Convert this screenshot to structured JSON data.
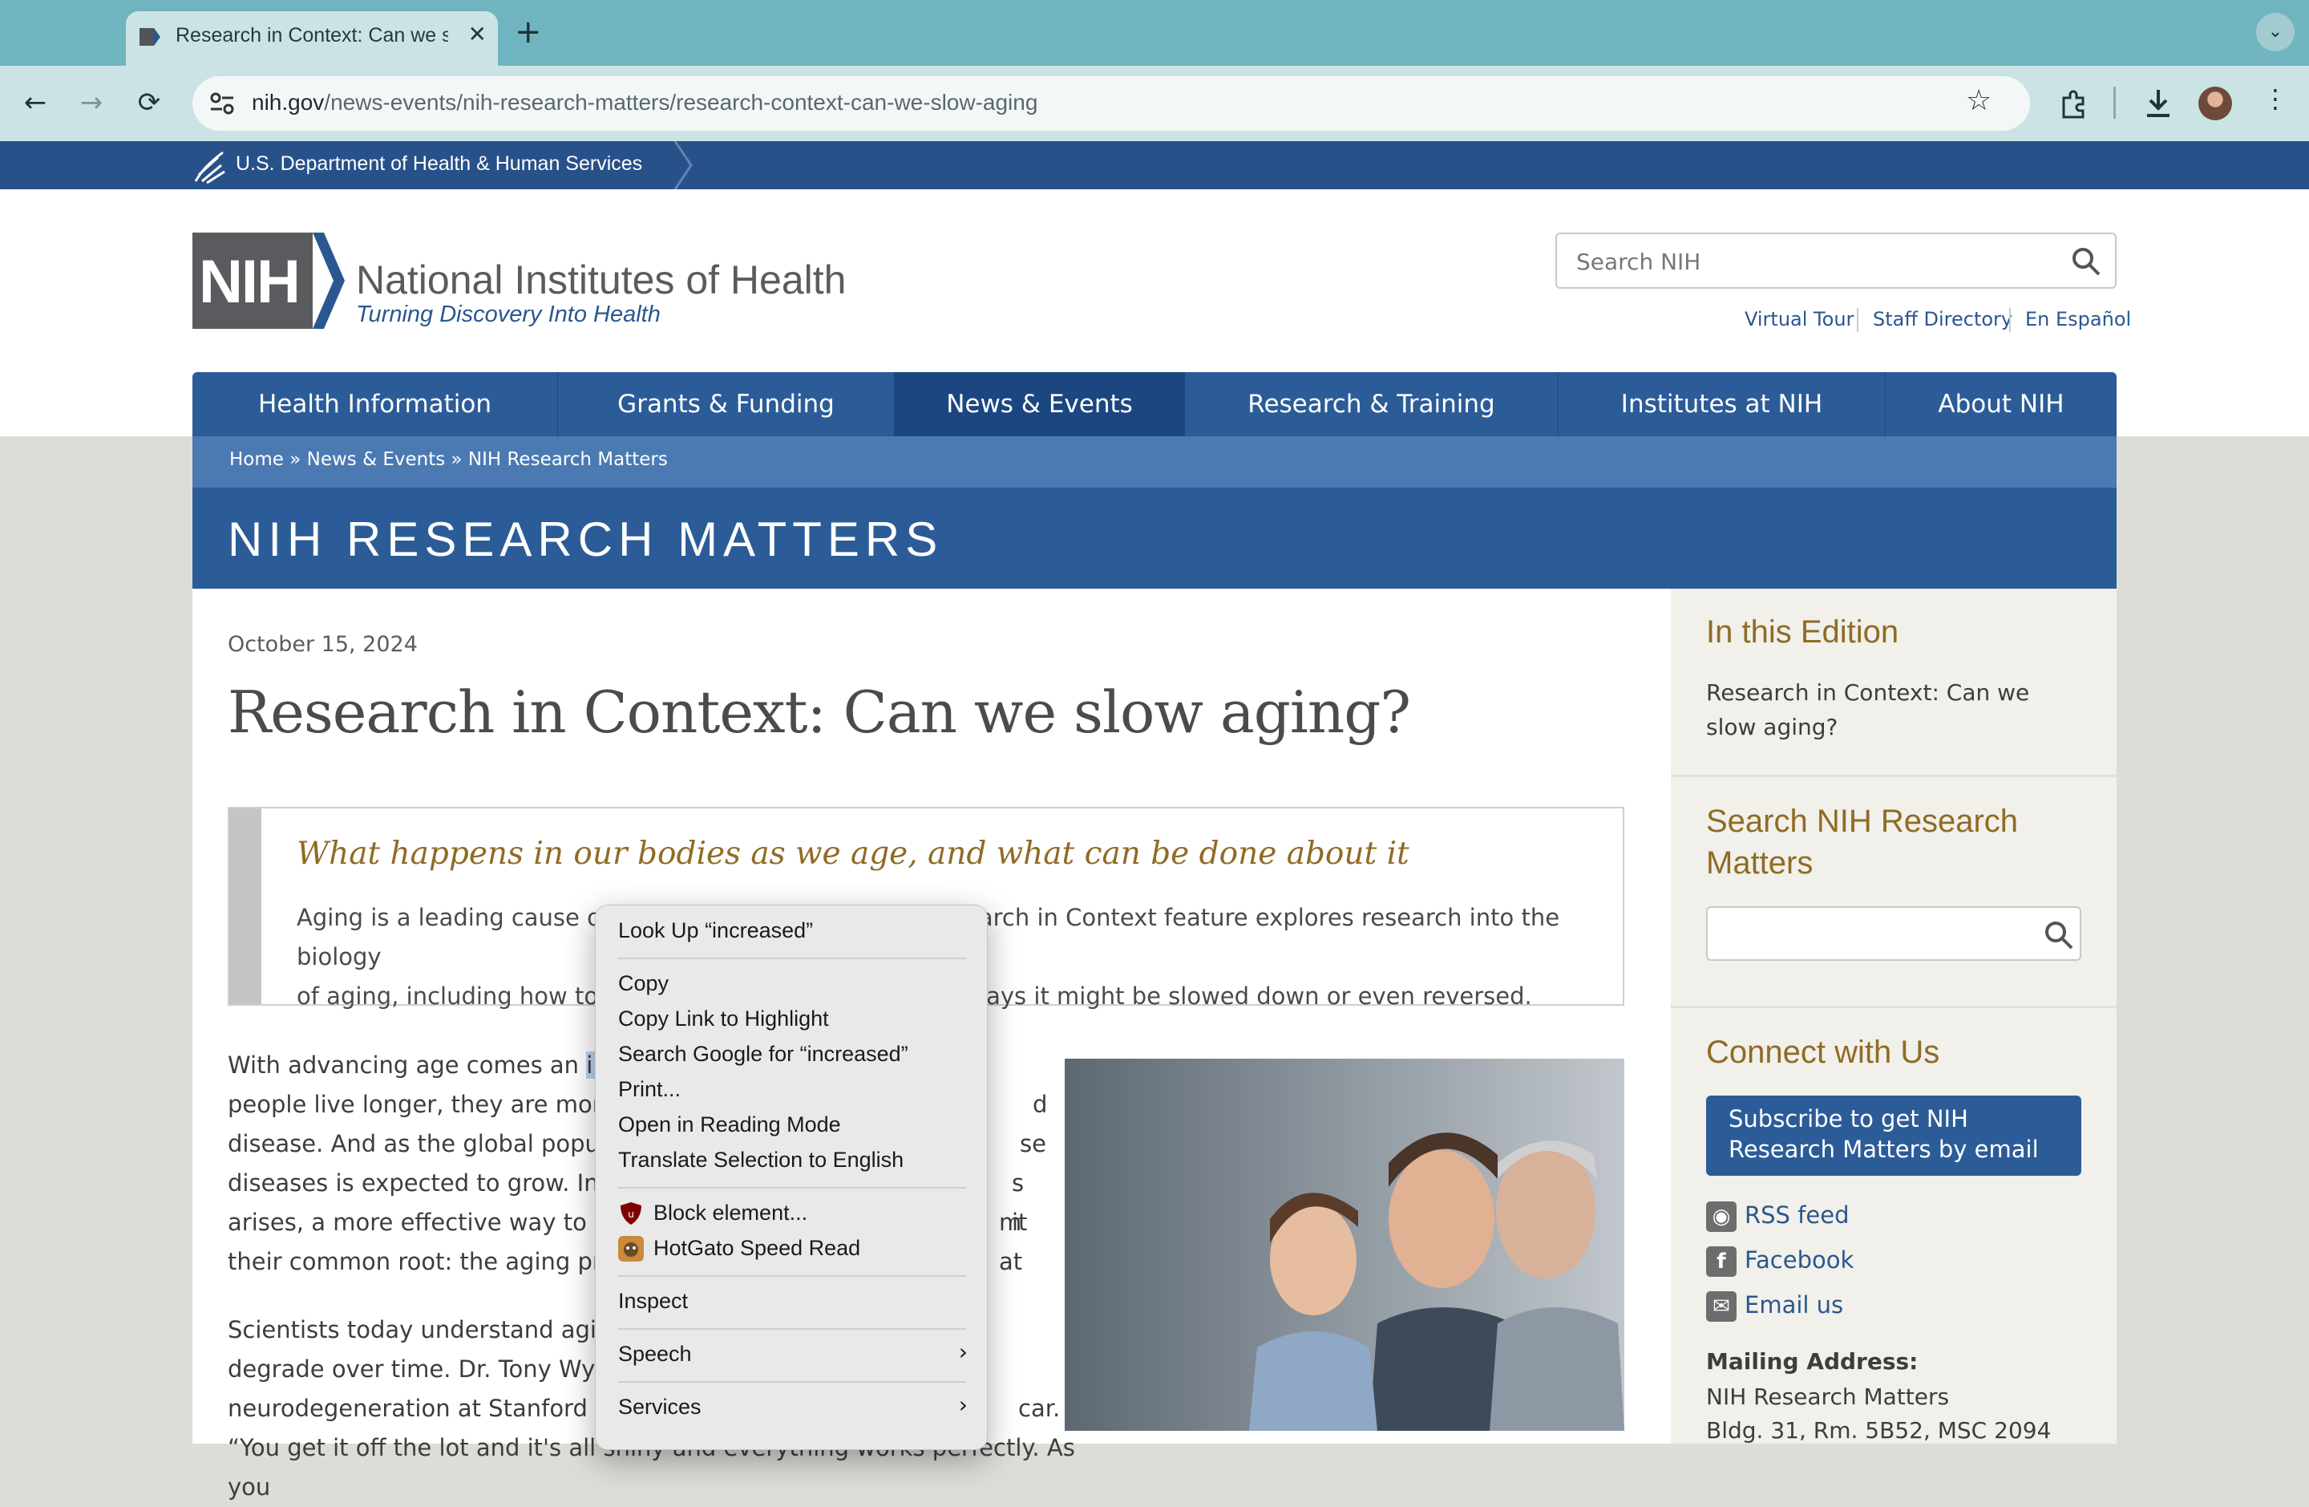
{
  "browser": {
    "tab_title": "Research in Context: Can we slow aging? | National Institutes of Health (NIH)",
    "new_tab": "+",
    "tab_menu": "⌄",
    "url_host": "nih.gov",
    "url_path": "/news-events/nih-research-matters/research-context-can-we-slow-aging"
  },
  "hhs_bar": {
    "text": "U.S. Department of Health & Human Services"
  },
  "header": {
    "logo_text": "NIH",
    "title": "National Institutes of Health",
    "tagline": "Turning Discovery Into Health",
    "search_placeholder": "Search NIH",
    "links": [
      "Virtual Tour",
      "Staff Directory",
      "En Español"
    ]
  },
  "nav": [
    "Health Information",
    "Grants & Funding",
    "News & Events",
    "Research & Training",
    "Institutes at NIH",
    "About NIH"
  ],
  "breadcrumb": "Home » News & Events » NIH Research Matters",
  "banner": "NIH RESEARCH MATTERS",
  "article": {
    "date": "October 15, 2024",
    "title": "Research in Context: Can we slow aging?",
    "intro_heading": "What happens in our bodies as we age, and what can be done about it",
    "intro_line1_a": "Aging is a leading cause of dis",
    "intro_line1_b": "arch in Context feature explores research into the biology",
    "intro_line2_a": "of aging, including how to me",
    "intro_line2_b": "ways it might be slowed down or even reversed.",
    "p1": [
      {
        "a": "With advancing age comes an ",
        "hl": "increa",
        "b": ""
      },
      {
        "a": "people live longer, they are more lik",
        "b": "d"
      },
      {
        "a": "disease. And as the global populatio",
        "b": "se"
      },
      {
        "a": "diseases is expected to grow. Instea",
        "b": "s it"
      },
      {
        "a": "arises, a more effective way to redu",
        "b": "m at"
      },
      {
        "a": "their common root: the aging proce",
        "b": ""
      }
    ],
    "p2": [
      {
        "a": "Scientists today understand aging a",
        "b": ""
      },
      {
        "a": "degrade over time. Dr. Tony Wyss-C",
        "b": ""
      },
      {
        "a": "neurodegeneration at Stanford Univ",
        "b": "car."
      },
      {
        "a": "“You get it off the lot and it's all shiny and everything works perfectly. As you",
        "b": ""
      }
    ]
  },
  "sidebar": {
    "edition_heading": "In this Edition",
    "edition_item": "Research in Context: Can we slow aging?",
    "search_heading": "Search NIH Research Matters",
    "connect_heading": "Connect with Us",
    "subscribe": "Subscribe to get NIH Research Matters by email",
    "rss": "RSS feed",
    "facebook": "Facebook",
    "email": "Email us",
    "mailing_label": "Mailing Address:",
    "mailing_1": "NIH Research Matters",
    "mailing_2": "Bldg. 31, Rm. 5B52, MSC 2094"
  },
  "context_menu": {
    "look_up": "Look Up “increased”",
    "copy": "Copy",
    "copy_link": "Copy Link to Highlight",
    "search_google": "Search Google for “increased”",
    "print": "Print...",
    "reading_mode": "Open in Reading Mode",
    "translate": "Translate Selection to English",
    "block": "Block element...",
    "speed_read": "HotGato Speed Read",
    "inspect": "Inspect",
    "speech": "Speech",
    "services": "Services",
    "arrow": "›"
  }
}
